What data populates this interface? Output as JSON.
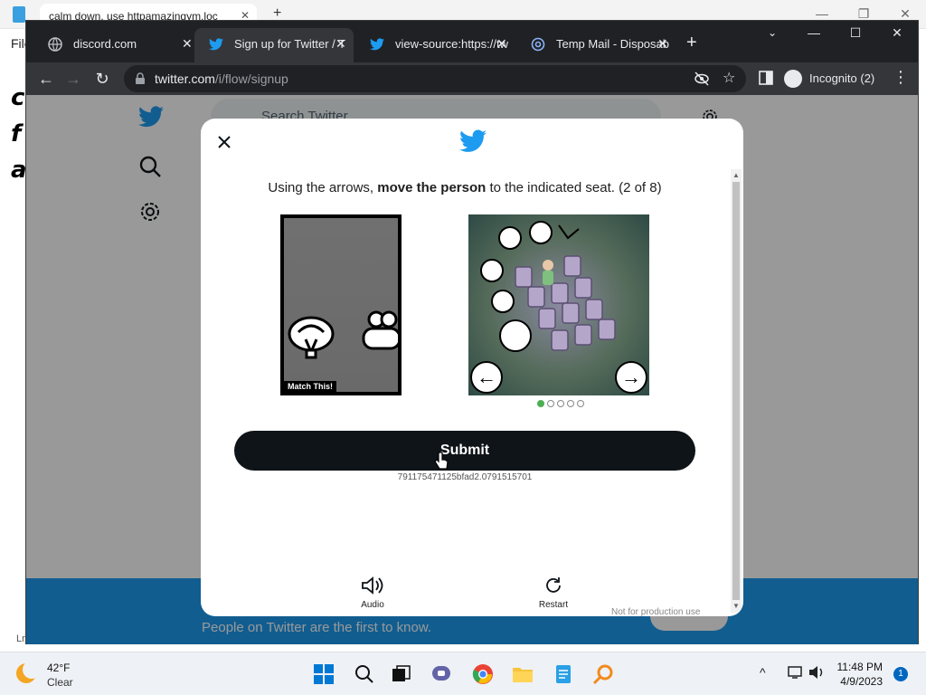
{
  "notepad": {
    "tab_title": "calm down. use httpamazingym.loc",
    "menu": "File",
    "text_lines": [
      "c",
      "f",
      "a"
    ],
    "status": "Ln"
  },
  "browser": {
    "tabs": [
      {
        "title": "discord.com",
        "icon": "discord-icon"
      },
      {
        "title": "Sign up for Twitter / T",
        "icon": "twitter-icon",
        "active": true
      },
      {
        "title": "view-source:https://tw",
        "icon": "twitter-icon"
      },
      {
        "title": "Temp Mail - Disposab",
        "icon": "at-icon"
      }
    ],
    "url_host": "twitter.com",
    "url_path": "/i/flow/signup",
    "profile_label": "Incognito (2)"
  },
  "twitter_page": {
    "search_placeholder": "Search Twitter",
    "bottom_text": "People on Twitter are the first to know."
  },
  "captcha": {
    "instruction_prefix": "Using the arrows, ",
    "instruction_bold": "move the person",
    "instruction_suffix": " to the indicated seat. (2 of 8)",
    "match_label": "Match This!",
    "submit_label": "Submit",
    "session_code": "791175471125bfad2.0791515701",
    "audio_label": "Audio",
    "restart_label": "Restart",
    "footer_note": "Not for production use",
    "progress": {
      "current": 1,
      "total": 5
    }
  },
  "taskbar": {
    "temperature": "42°F",
    "condition": "Clear",
    "time": "11:48 PM",
    "date": "4/9/2023",
    "notification_count": "1"
  },
  "colors": {
    "twitter_blue": "#1d9bf0",
    "chrome_dark": "#202124",
    "submit_black": "#0f1419"
  }
}
